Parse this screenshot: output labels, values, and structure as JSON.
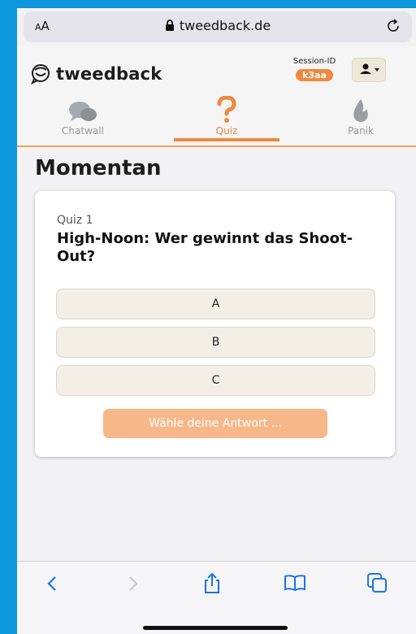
{
  "browser": {
    "aa_label": "AA",
    "url": "tweedback.de",
    "icons": [
      "lock-icon",
      "reload-icon",
      "back-icon",
      "forward-icon",
      "share-icon",
      "bookmarks-icon",
      "tabs-icon"
    ]
  },
  "app": {
    "logo_text": "tweedback",
    "session_label": "Session-ID",
    "session_id": "k3aa",
    "tabs": [
      {
        "label": "Chatwall",
        "icon": "chat-bubbles-icon"
      },
      {
        "label": "Quiz",
        "icon": "question-mark-icon"
      },
      {
        "label": "Panik",
        "icon": "flame-icon"
      }
    ],
    "active_tab": "Quiz"
  },
  "main": {
    "heading": "Momentan",
    "quiz": {
      "label": "Quiz 1",
      "question": "High-Noon: Wer gewinnt das Shoot-Out?",
      "options": [
        "A",
        "B",
        "C"
      ],
      "submit_label": "Wähle deine Antwort ..."
    }
  },
  "colors": {
    "accent": "#f0883e",
    "frame": "#0d97dc"
  }
}
